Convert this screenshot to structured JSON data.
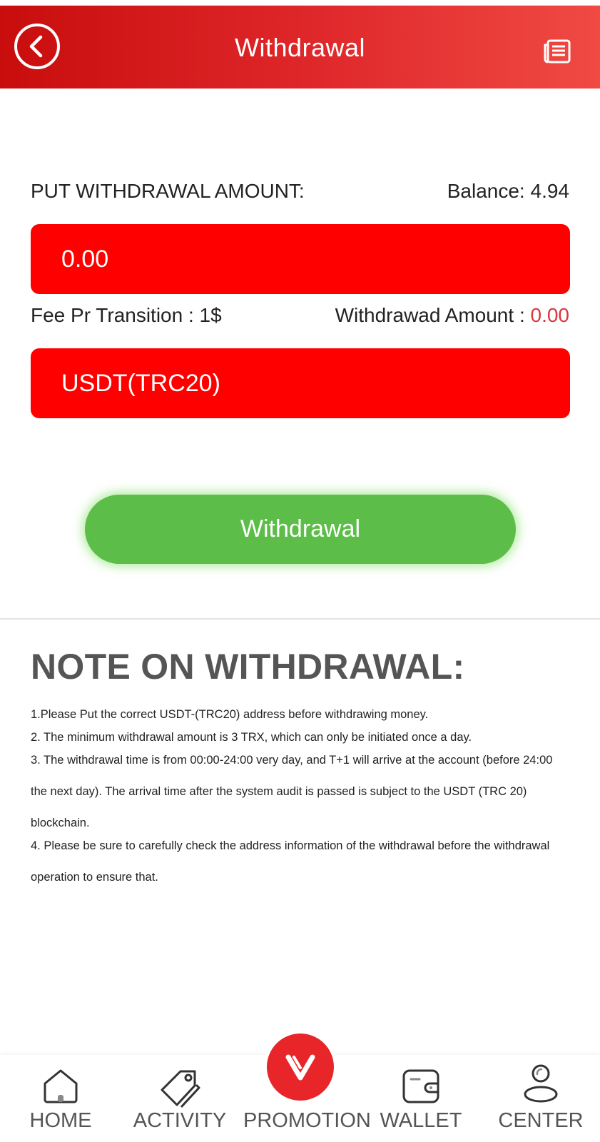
{
  "header": {
    "title": "Withdrawal",
    "back_icon": "back-arrow-circle-icon",
    "record_icon": "record-list-icon"
  },
  "form": {
    "amount_label": "PUT WITHDRAWAL AMOUNT:",
    "balance_text": "Balance: 4.94",
    "amount_placeholder": "0.00",
    "fee_text": "Fee Pr Transition : 1$",
    "withdraw_amount_label": "Withdrawad Amount : ",
    "withdraw_amount_value": "0.00",
    "network_value": "USDT(TRC20)",
    "submit_label": "Withdrawal"
  },
  "note": {
    "title": "NOTE ON WITHDRAWAL:",
    "lines": [
      "1.Please Put the correct USDT-(TRC20) address before withdrawing money.",
      "2. The minimum withdrawal amount is 3 TRX, which can only be initiated once a day.",
      "3. The withdrawal time is from 00:00-24:00 very day, and T+1 will arrive at the account (before 24:00",
      "the next day). The arrival time after the system audit is passed is subject to the USDT (TRC 20)",
      "blockchain.",
      "4. Please be sure to carefully check the address information of the withdrawal before the withdrawal",
      "operation to ensure that."
    ]
  },
  "nav": {
    "items": [
      {
        "label": "HOME",
        "icon": "home-icon"
      },
      {
        "label": "ACTIVITY",
        "icon": "tag-icon"
      },
      {
        "label": "PROMOTION",
        "icon": "promotion-icon"
      },
      {
        "label": "WALLET",
        "icon": "wallet-icon"
      },
      {
        "label": "CENTER",
        "icon": "user-icon"
      }
    ]
  },
  "colors": {
    "header_gradient_start": "#c90d0d",
    "header_gradient_end": "#f04a43",
    "field_red": "#ff0000",
    "button_green": "#5cbd49",
    "amount_value_red": "#d9363e",
    "note_title_gray": "#555555"
  }
}
